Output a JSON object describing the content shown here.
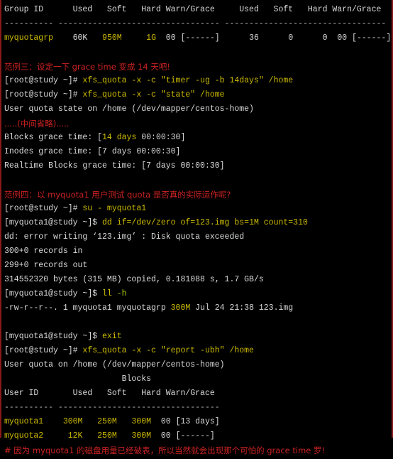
{
  "terminal": {
    "title": "xfs_quota terminal session",
    "colors": {
      "background": "#000000",
      "foreground": "#d9d9d9",
      "yellow": "#cdbb00",
      "green_yellow": "#a8c400",
      "red": "#cc2222",
      "border": "#8b1a1a"
    },
    "lines": [
      {
        "id": "grp-header",
        "segments": [
          {
            "text": "Group ID      Used   Soft   Hard Warn/Grace     Used   Soft   Hard Warn/Grace",
            "color": "w"
          }
        ]
      },
      {
        "id": "grp-divider",
        "segments": [
          {
            "text": "---------- --------------------------------- ---------------------------------",
            "color": "dash"
          }
        ]
      },
      {
        "id": "grp-row-myquotagrp",
        "segments": [
          {
            "text": "myquotagrp    ",
            "color": "y"
          },
          {
            "text": "60K   ",
            "color": "w"
          },
          {
            "text": "950M     ",
            "color": "y"
          },
          {
            "text": "1G",
            "color": "y"
          },
          {
            "text": "  00 [------]      36      0      0  00 [------]",
            "color": "w"
          }
        ]
      },
      {
        "id": "blank-1",
        "segments": [
          {
            "text": " ",
            "color": "w"
          }
        ]
      },
      {
        "id": "example3-title",
        "segments": [
          {
            "text": "范例三：设定一下 grace time 变成 14 天吧!",
            "color": "r",
            "cjk": true
          }
        ]
      },
      {
        "id": "cmd-timer",
        "segments": [
          {
            "text": "[root@study ~]# ",
            "color": "w"
          },
          {
            "text": "xfs_quota -x -c \"timer -ug -b 14days\" /home",
            "color": "y"
          }
        ]
      },
      {
        "id": "cmd-state",
        "segments": [
          {
            "text": "[root@study ~]# ",
            "color": "w"
          },
          {
            "text": "xfs_quota -x -c \"state\" /home",
            "color": "y"
          }
        ]
      },
      {
        "id": "out-user-quota-state",
        "segments": [
          {
            "text": "User quota state on /home (/dev/mapper/centos-home)",
            "color": "w"
          }
        ]
      },
      {
        "id": "out-omitted",
        "segments": [
          {
            "text": ".....(中间省略).....",
            "color": "r",
            "cjk": true
          }
        ]
      },
      {
        "id": "out-blocks-grace",
        "segments": [
          {
            "text": "Blocks grace time: [",
            "color": "w"
          },
          {
            "text": "14 days",
            "color": "y"
          },
          {
            "text": " 00:00:30]",
            "color": "w"
          }
        ]
      },
      {
        "id": "out-inodes-grace",
        "segments": [
          {
            "text": "Inodes grace time: [7 days 00:00:30]",
            "color": "w"
          }
        ]
      },
      {
        "id": "out-realtime-grace",
        "segments": [
          {
            "text": "Realtime Blocks grace time: [7 days 00:00:30]",
            "color": "w"
          }
        ]
      },
      {
        "id": "blank-2",
        "segments": [
          {
            "text": " ",
            "color": "w"
          }
        ]
      },
      {
        "id": "example4-title",
        "segments": [
          {
            "text": "范例四：以 myquota1 用户测试 quota 是否真的实际运作呢?",
            "color": "r",
            "cjk": true
          }
        ]
      },
      {
        "id": "cmd-su",
        "segments": [
          {
            "text": "[root@study ~]# ",
            "color": "w"
          },
          {
            "text": "su - myquota1",
            "color": "y"
          }
        ]
      },
      {
        "id": "cmd-dd",
        "segments": [
          {
            "text": "[myquota1@study ~]$ ",
            "color": "w"
          },
          {
            "text": "dd if=/dev/zero of=123.img bs=1M count=310",
            "color": "y"
          }
        ]
      },
      {
        "id": "out-dd-error",
        "segments": [
          {
            "text": "dd: error writing ‘123.img’ : Disk quota exceeded",
            "color": "w"
          }
        ]
      },
      {
        "id": "out-records-in",
        "segments": [
          {
            "text": "300+0 records in",
            "color": "w"
          }
        ]
      },
      {
        "id": "out-records-out",
        "segments": [
          {
            "text": "299+0 records out",
            "color": "w"
          }
        ]
      },
      {
        "id": "out-bytes-copied",
        "segments": [
          {
            "text": "314552320 bytes (315 MB) copied, 0.181088 s, 1.7 GB/s",
            "color": "w"
          }
        ]
      },
      {
        "id": "cmd-ll",
        "segments": [
          {
            "text": "[myquota1@study ~]$ ",
            "color": "w"
          },
          {
            "text": "ll ",
            "color": "y"
          },
          {
            "text": "-h",
            "color": "gy"
          }
        ]
      },
      {
        "id": "out-ll-listing",
        "segments": [
          {
            "text": "-rw-r--r--. 1 myquota1 myquotagrp ",
            "color": "w"
          },
          {
            "text": "300M",
            "color": "y"
          },
          {
            "text": " Jul 24 21:38 123.img",
            "color": "w"
          }
        ]
      },
      {
        "id": "blank-3",
        "segments": [
          {
            "text": " ",
            "color": "w"
          }
        ]
      },
      {
        "id": "cmd-exit",
        "segments": [
          {
            "text": "[myquota1@study ~]$ ",
            "color": "w"
          },
          {
            "text": "exit",
            "color": "y"
          }
        ]
      },
      {
        "id": "cmd-report",
        "segments": [
          {
            "text": "[root@study ~]# ",
            "color": "w"
          },
          {
            "text": "xfs_quota -x -c \"report -ubh\" /home",
            "color": "y"
          }
        ]
      },
      {
        "id": "out-user-quota-on",
        "segments": [
          {
            "text": "User quota on /home (/dev/mapper/centos-home)",
            "color": "w"
          }
        ]
      },
      {
        "id": "out-blocks-label",
        "segments": [
          {
            "text": "                        Blocks",
            "color": "w"
          }
        ]
      },
      {
        "id": "user-header",
        "segments": [
          {
            "text": "User ID       Used   Soft   Hard Warn/Grace",
            "color": "w"
          }
        ]
      },
      {
        "id": "user-divider",
        "segments": [
          {
            "text": "---------- ---------------------------------",
            "color": "dash"
          }
        ]
      },
      {
        "id": "user-row-myquota1",
        "segments": [
          {
            "text": "myquota1    ",
            "color": "y"
          },
          {
            "text": "300M   ",
            "color": "y"
          },
          {
            "text": "250M   ",
            "color": "y"
          },
          {
            "text": "300M",
            "color": "y"
          },
          {
            "text": "  00 [13 days]",
            "color": "w"
          }
        ]
      },
      {
        "id": "user-row-myquota2",
        "segments": [
          {
            "text": "myquota2     ",
            "color": "y"
          },
          {
            "text": "12K   ",
            "color": "y"
          },
          {
            "text": "250M   ",
            "color": "y"
          },
          {
            "text": "300M",
            "color": "y"
          },
          {
            "text": "  00 [------]",
            "color": "w"
          }
        ]
      },
      {
        "id": "footer-comment",
        "segments": [
          {
            "text": "# 因为 myquota1 的磁盘用量已经破表，所以当然就会出现那个可怕的 grace time 罗!",
            "color": "r",
            "cjk": true
          }
        ]
      }
    ]
  }
}
